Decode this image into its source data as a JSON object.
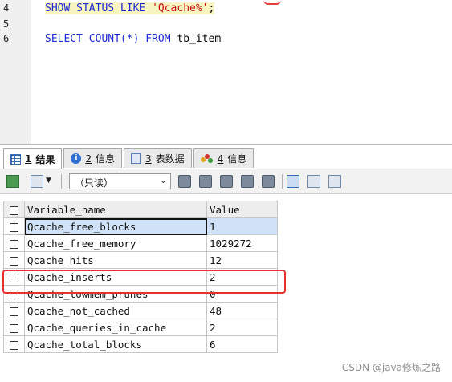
{
  "editor": {
    "lines": [
      {
        "num": "4",
        "code": [
          {
            "t": "SHOW STATUS LIKE ",
            "k": "kw"
          },
          {
            "t": "'Qcache%'",
            "k": "str"
          },
          {
            "t": ";",
            "k": "plain"
          }
        ]
      },
      {
        "num": "5",
        "code": []
      },
      {
        "num": "6",
        "code": [
          {
            "t": "SELECT COUNT(*) FROM ",
            "k": "kw"
          },
          {
            "t": "tb_item",
            "k": "plain"
          }
        ]
      }
    ]
  },
  "tabs": [
    {
      "num": "1",
      "label": "结果",
      "icon": "result-grid-icon"
    },
    {
      "num": "2",
      "label": "信息",
      "icon": "info-icon"
    },
    {
      "num": "3",
      "label": "表数据",
      "icon": "table-data-icon"
    },
    {
      "num": "4",
      "label": "信息",
      "icon": "shapes-info-icon"
    }
  ],
  "toolbar": {
    "mode_value": "（只读）",
    "dropdown_glyph": "⌄"
  },
  "grid": {
    "columns": [
      "Variable_name",
      "Value"
    ],
    "rows": [
      {
        "name": "Qcache_free_blocks",
        "value": "1"
      },
      {
        "name": "Qcache_free_memory",
        "value": "1029272"
      },
      {
        "name": "Qcache_hits",
        "value": "12"
      },
      {
        "name": "Qcache_inserts",
        "value": "2"
      },
      {
        "name": "Qcache_lowmem_prunes",
        "value": "0"
      },
      {
        "name": "Qcache_not_cached",
        "value": "48"
      },
      {
        "name": "Qcache_queries_in_cache",
        "value": "2"
      },
      {
        "name": "Qcache_total_blocks",
        "value": "6"
      }
    ]
  },
  "watermark": "CSDN @java修炼之路",
  "colors": {
    "keyword": "#1e2bd0",
    "string": "#c01010",
    "highlight": "#e5322e",
    "selection": "#cfe2f7"
  }
}
